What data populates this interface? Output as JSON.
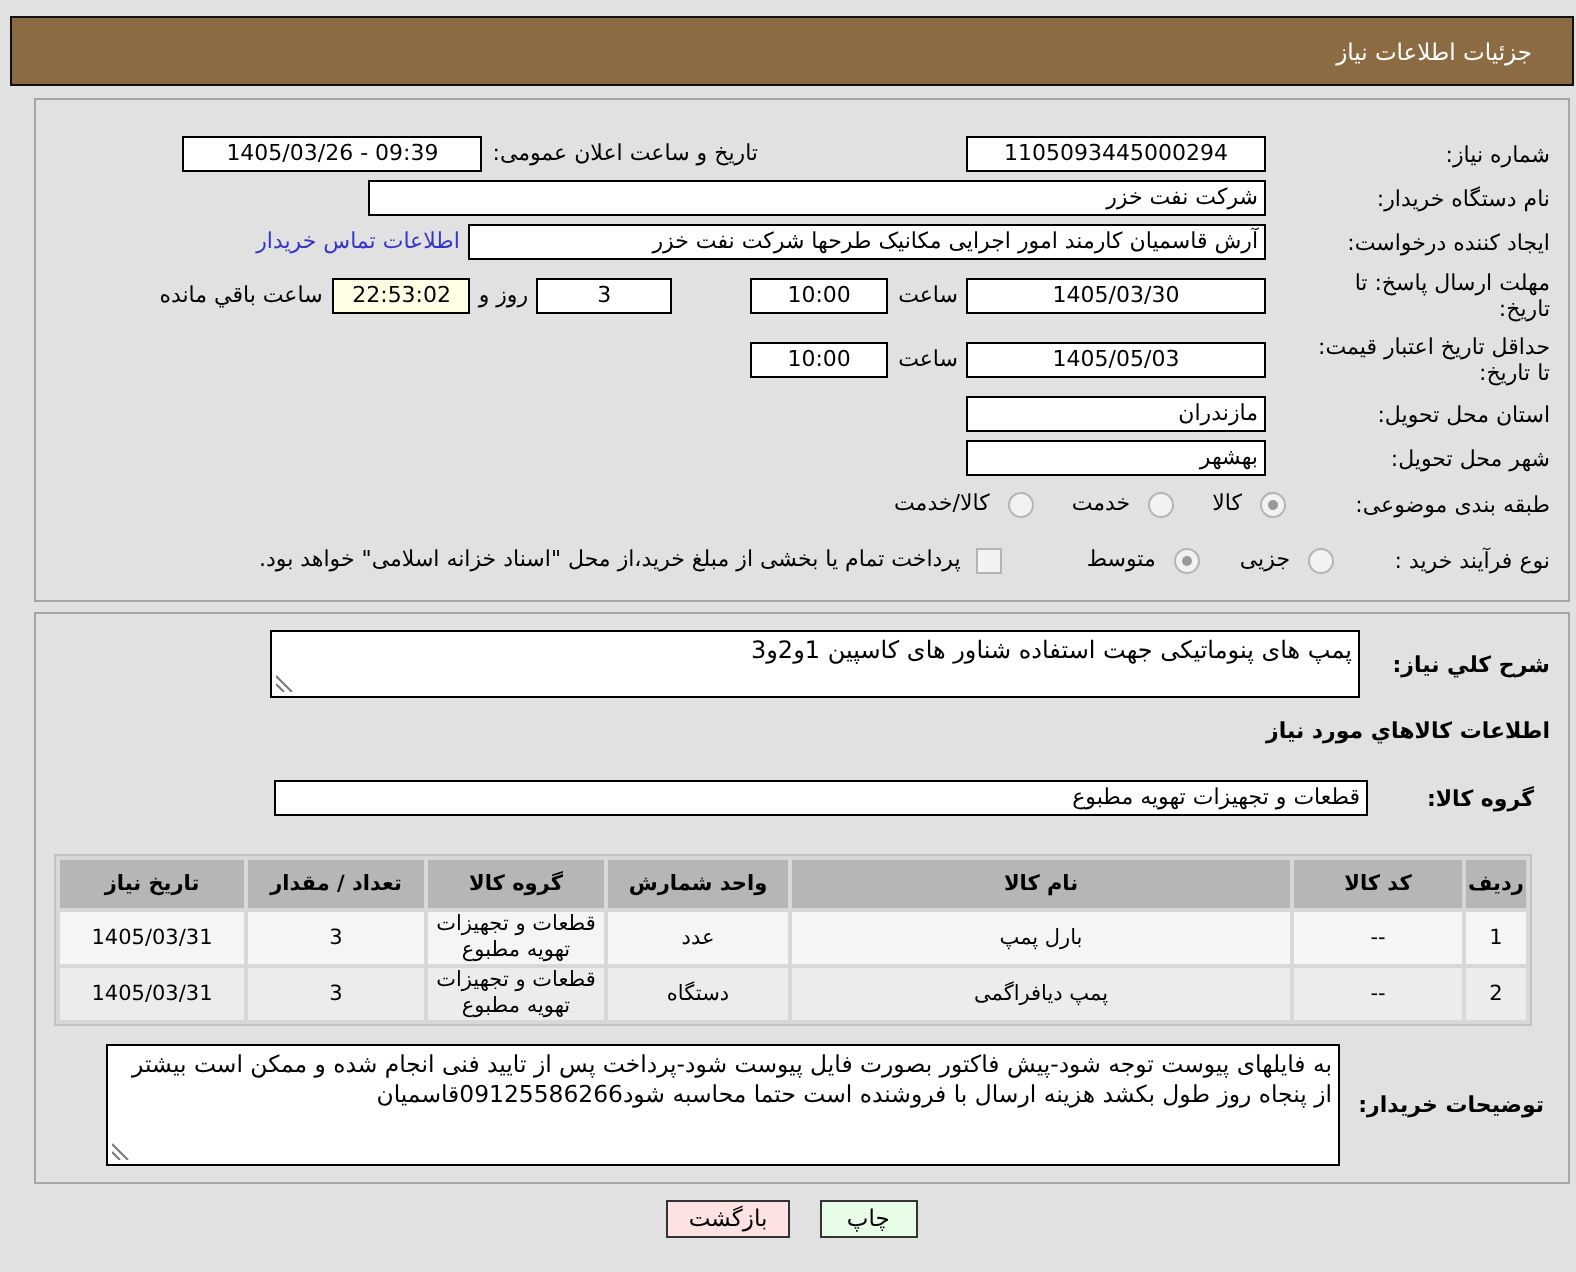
{
  "header": {
    "title": "جزئیات اطلاعات نیاز"
  },
  "summary": {
    "need_number": {
      "label": "شماره نیاز:",
      "value": "1105093445000294"
    },
    "announce_time": {
      "label": "تاریخ و ساعت اعلان عمومی:",
      "value": "1405/03/26 - 09:39"
    },
    "buyer_org": {
      "label": "نام دستگاه خریدار:",
      "value": "شرکت نفت خزر"
    },
    "requester": {
      "label": "ایجاد کننده درخواست:",
      "value": "آرش قاسمیان کارمند امور اجرایی مکانیک طرحها شرکت نفت خزر",
      "contact_link": "اطلاعات تماس خریدار"
    },
    "reply_deadline": {
      "label": "مهلت ارسال پاسخ: تا تاریخ:",
      "date": "1405/03/30",
      "time_label": "ساعت",
      "time": "10:00",
      "days": "3",
      "days_label": "روز و",
      "remaining": "22:53:02",
      "remaining_label": "ساعت باقي مانده"
    },
    "price_validity": {
      "label": "حداقل تاریخ اعتبار قیمت: تا تاریخ:",
      "date": "1405/05/03",
      "time_label": "ساعت",
      "time": "10:00"
    },
    "province": {
      "label": "استان محل تحویل:",
      "value": "مازندران"
    },
    "city": {
      "label": "شهر محل تحویل:",
      "value": "بهشهر"
    },
    "category": {
      "label": "طبقه بندی موضوعی:",
      "options": [
        {
          "label": "کالا",
          "selected": true,
          "disabled": true
        },
        {
          "label": "خدمت",
          "selected": false,
          "disabled": true
        },
        {
          "label": "کالا/خدمت",
          "selected": false,
          "disabled": true
        }
      ]
    },
    "purchase_process": {
      "label": "نوع فرآیند خرید :",
      "options": [
        {
          "label": "جزیی",
          "selected": false,
          "disabled": true
        },
        {
          "label": "متوسط",
          "selected": true,
          "disabled": true
        }
      ],
      "treasury_option": {
        "label": "پرداخت تمام یا بخشی از مبلغ خرید،از محل \"اسناد خزانه اسلامی\" خواهد بود.",
        "checked": false,
        "disabled": true
      }
    }
  },
  "need": {
    "description_label": "شرح کلي نیاز:",
    "description": "پمپ های پنوماتیکی جهت استفاده شناور های کاسپین 1و2و3",
    "goods_heading": "اطلاعات کالاهاي مورد نیاز",
    "group_label": "گروه کالا:",
    "group": "قطعات و تجهیزات تهویه مطبوع"
  },
  "table": {
    "columns": [
      "ردیف",
      "کد کالا",
      "نام کالا",
      "واحد شمارش",
      "گروه کالا",
      "تعداد / مقدار",
      "تاریخ نیاز"
    ],
    "rows": [
      [
        "1",
        "--",
        "بارل پمپ",
        "عدد",
        "قطعات و تجهیزات تهویه مطبوع",
        "3",
        "1405/03/31"
      ],
      [
        "2",
        "--",
        "پمپ دیافراگمی",
        "دستگاه",
        "قطعات و تجهیزات تهویه مطبوع",
        "3",
        "1405/03/31"
      ]
    ]
  },
  "buyer_notes": {
    "label": "توضیحات خریدار:",
    "text": "به فایلهای پیوست توجه شود-پیش فاکتور بصورت فایل پیوست شود-پرداخت پس از تایید فنی انجام شده و ممکن است بیشتر از پنجاه روز طول بکشد هزینه ارسال با فروشنده است حتما محاسبه شود09125586266قاسمیان"
  },
  "buttons": [
    {
      "label": "چاپ",
      "kind": "print"
    },
    {
      "label": "بازگشت",
      "kind": "back"
    }
  ]
}
